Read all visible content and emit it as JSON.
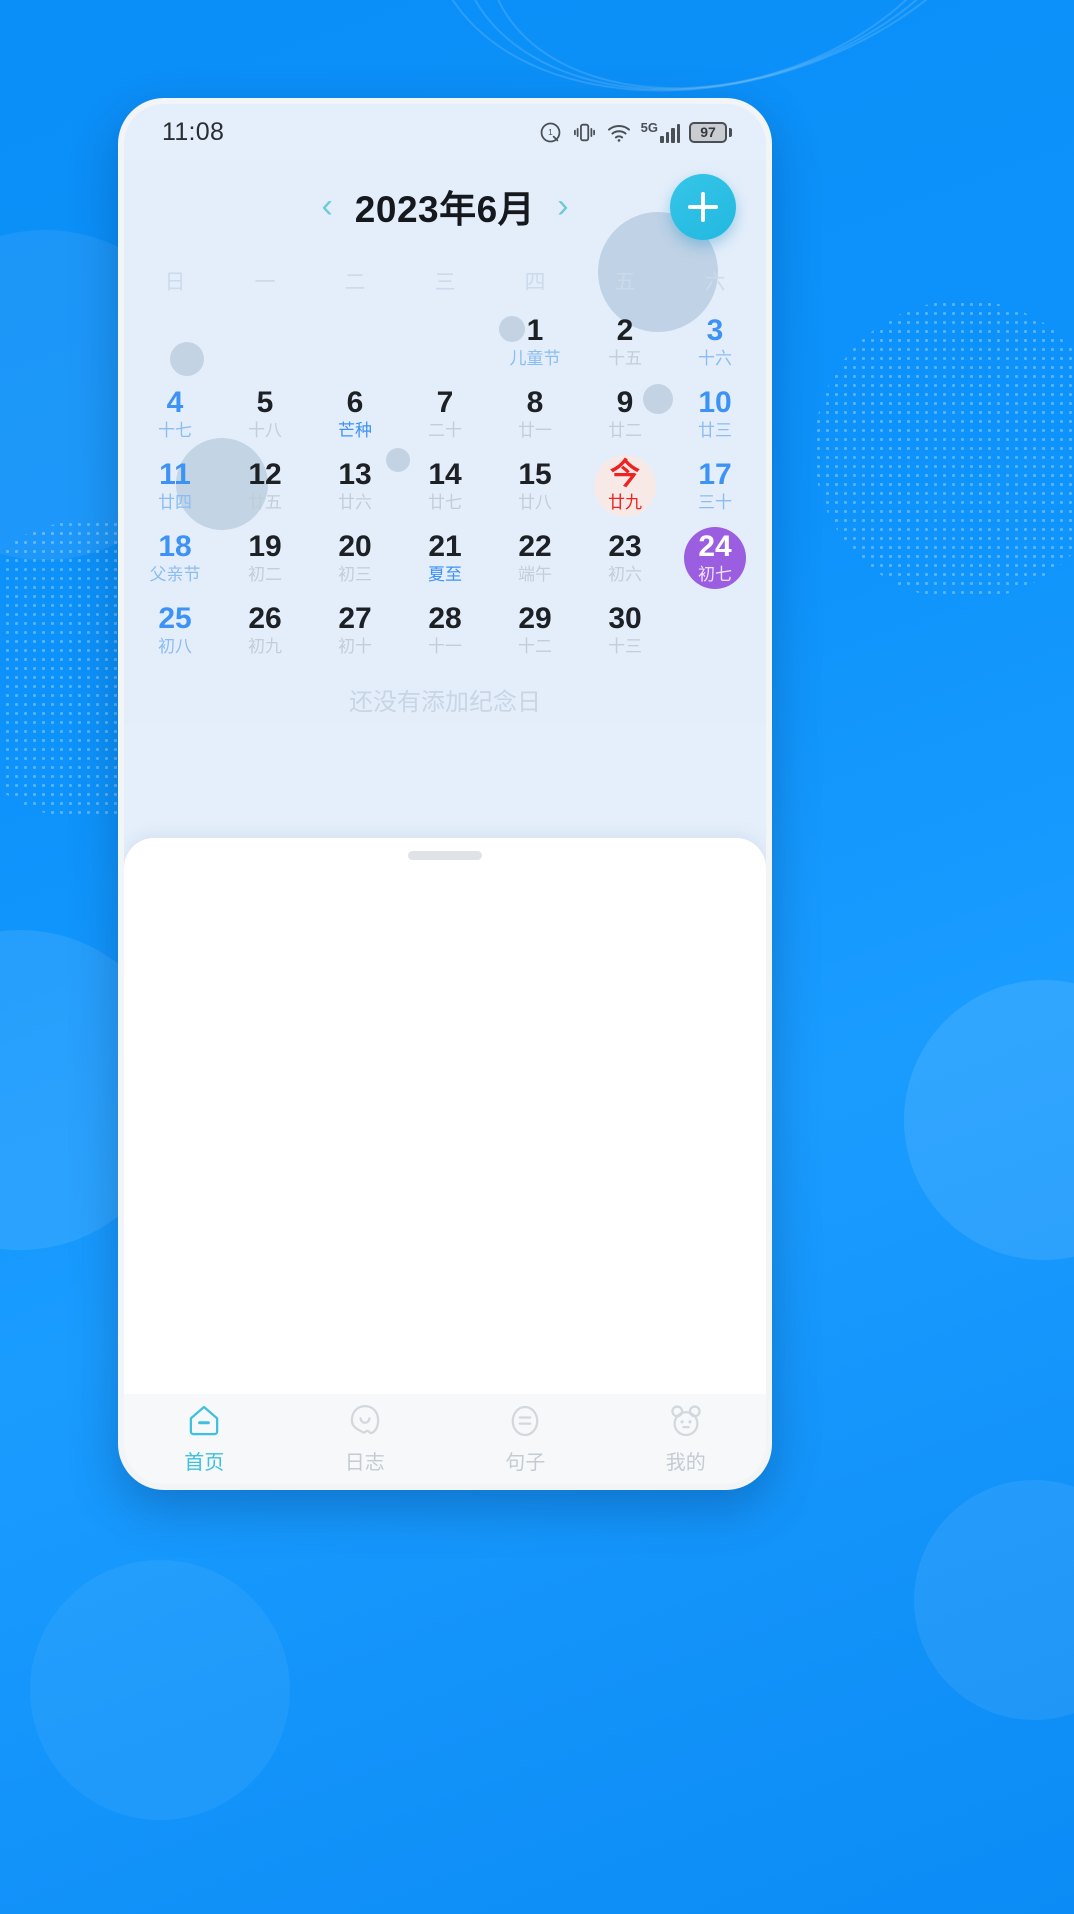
{
  "statusbar": {
    "time": "11:08",
    "icons": [
      "alarm-timer-icon",
      "vibrate-icon",
      "wifi-icon",
      "signal-5g-icon"
    ],
    "network_label": "5G",
    "battery_level": "97"
  },
  "calendar": {
    "title": "2023年6月",
    "prev_label": "‹",
    "next_label": "›",
    "add_label": "+",
    "weekdays": [
      "日",
      "一",
      "二",
      "三",
      "四",
      "五",
      "六"
    ],
    "leading_blanks": 4,
    "empty_hint": "还没有添加纪念日",
    "accent_today": "#ef2222",
    "accent_selected": "#9b5ee0",
    "accent_weekend": "#3d92f5",
    "accent_fab": "#22b8e0",
    "days": [
      {
        "num": "1",
        "sub": "儿童节",
        "kind": "fest"
      },
      {
        "num": "2",
        "sub": "十五",
        "kind": "normal"
      },
      {
        "num": "3",
        "sub": "十六",
        "kind": "weekend"
      },
      {
        "num": "4",
        "sub": "十七",
        "kind": "weekend"
      },
      {
        "num": "5",
        "sub": "十八",
        "kind": "normal"
      },
      {
        "num": "6",
        "sub": "芒种",
        "kind": "term"
      },
      {
        "num": "7",
        "sub": "二十",
        "kind": "normal"
      },
      {
        "num": "8",
        "sub": "廿一",
        "kind": "normal"
      },
      {
        "num": "9",
        "sub": "廿二",
        "kind": "normal"
      },
      {
        "num": "10",
        "sub": "廿三",
        "kind": "weekend"
      },
      {
        "num": "11",
        "sub": "廿四",
        "kind": "weekend"
      },
      {
        "num": "12",
        "sub": "廿五",
        "kind": "normal"
      },
      {
        "num": "13",
        "sub": "廿六",
        "kind": "normal"
      },
      {
        "num": "14",
        "sub": "廿七",
        "kind": "normal"
      },
      {
        "num": "15",
        "sub": "廿八",
        "kind": "normal"
      },
      {
        "num": "今",
        "sub": "廿九",
        "kind": "today"
      },
      {
        "num": "17",
        "sub": "三十",
        "kind": "weekend"
      },
      {
        "num": "18",
        "sub": "父亲节",
        "kind": "weekend"
      },
      {
        "num": "19",
        "sub": "初二",
        "kind": "normal"
      },
      {
        "num": "20",
        "sub": "初三",
        "kind": "normal"
      },
      {
        "num": "21",
        "sub": "夏至",
        "kind": "term"
      },
      {
        "num": "22",
        "sub": "端午",
        "kind": "normal"
      },
      {
        "num": "23",
        "sub": "初六",
        "kind": "normal"
      },
      {
        "num": "24",
        "sub": "初七",
        "kind": "selected"
      },
      {
        "num": "25",
        "sub": "初八",
        "kind": "weekend"
      },
      {
        "num": "26",
        "sub": "初九",
        "kind": "normal"
      },
      {
        "num": "27",
        "sub": "初十",
        "kind": "normal"
      },
      {
        "num": "28",
        "sub": "十一",
        "kind": "normal"
      },
      {
        "num": "29",
        "sub": "十二",
        "kind": "normal"
      },
      {
        "num": "30",
        "sub": "十三",
        "kind": "normal"
      }
    ]
  },
  "bottomnav": {
    "items": [
      {
        "label": "首页",
        "icon": "home-icon",
        "active": true
      },
      {
        "label": "日志",
        "icon": "ghost-icon",
        "active": false
      },
      {
        "label": "句子",
        "icon": "face-icon",
        "active": false
      },
      {
        "label": "我的",
        "icon": "bear-icon",
        "active": false
      }
    ]
  }
}
